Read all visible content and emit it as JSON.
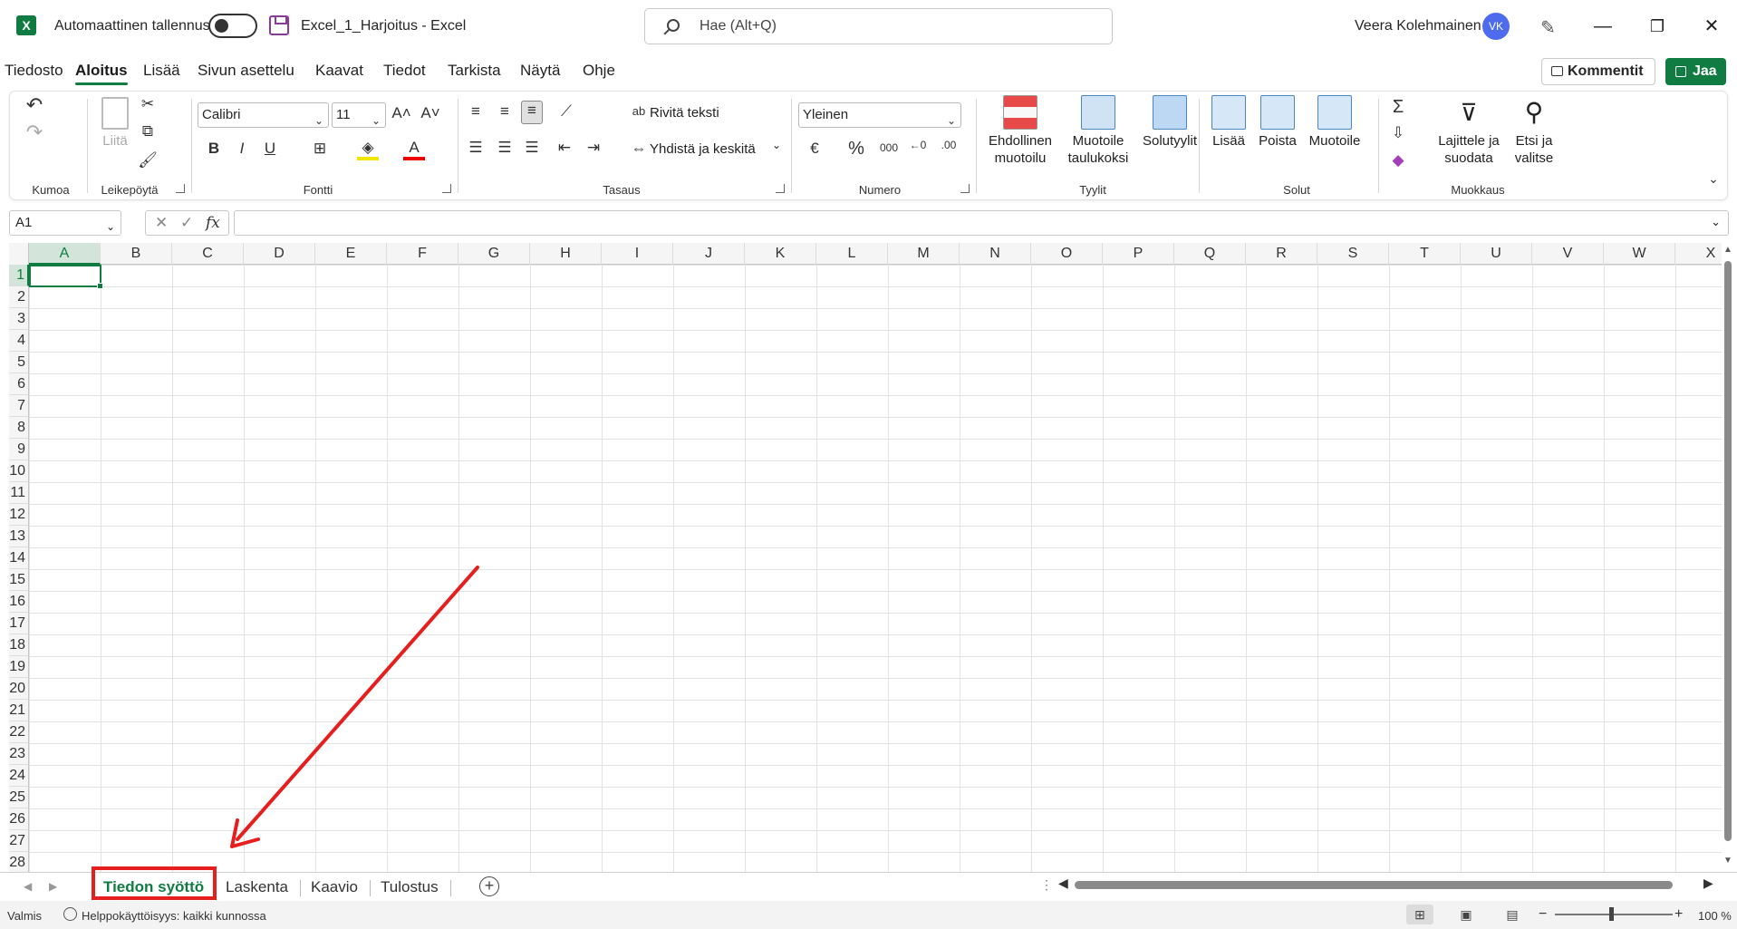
{
  "titlebar": {
    "app_logo": "X",
    "autosave_label": "Automaattinen tallennus",
    "doc_title": "Excel_1_Harjoitus  -  Excel",
    "search_placeholder": "Hae (Alt+Q)",
    "user_name": "Veera Kolehmainen",
    "user_initials": "VK",
    "minimize": "—",
    "restore": "❐",
    "close": "✕"
  },
  "menu": {
    "tabs": [
      "Tiedosto",
      "Aloitus",
      "Lisää",
      "Sivun asettelu",
      "Kaavat",
      "Tiedot",
      "Tarkista",
      "Näytä",
      "Ohje"
    ],
    "active_tab": "Aloitus",
    "comments_label": "Kommentit",
    "share_label": "Jaa"
  },
  "ribbon": {
    "groups": {
      "undo": "Kumoa",
      "clipboard": "Leikepöytä",
      "font": "Fontti",
      "alignment": "Tasaus",
      "number": "Numero",
      "styles": "Tyylit",
      "cells": "Solut",
      "editing": "Muokkaus"
    },
    "paste_label": "Liitä",
    "font_name": "Calibri",
    "font_size": "11",
    "bold": "B",
    "italic": "I",
    "underline": "U",
    "wrap_text": "Rivitä teksti",
    "merge_center": "Yhdistä ja keskitä",
    "number_format": "Yleinen",
    "percent": "%",
    "thousands": "000",
    "conditional_1": "Ehdollinen",
    "conditional_2": "muotoilu",
    "format_table_1": "Muotoile",
    "format_table_2": "taulukoksi",
    "cell_styles": "Solutyylit",
    "insert": "Lisää",
    "delete": "Poista",
    "format": "Muotoile",
    "sort_1": "Lajittele ja",
    "sort_2": "suodata",
    "find_1": "Etsi ja",
    "find_2": "valitse"
  },
  "formula_bar": {
    "name_box": "A1",
    "fx_label": "fx",
    "formula": ""
  },
  "grid": {
    "columns": [
      "A",
      "B",
      "C",
      "D",
      "E",
      "F",
      "G",
      "H",
      "I",
      "J",
      "K",
      "L",
      "M",
      "N",
      "O",
      "P",
      "Q",
      "R",
      "S",
      "T",
      "U",
      "V",
      "W",
      "X"
    ],
    "rows": [
      "1",
      "2",
      "3",
      "4",
      "5",
      "6",
      "7",
      "8",
      "9",
      "10",
      "11",
      "12",
      "13",
      "14",
      "15",
      "16",
      "17",
      "18",
      "19",
      "20",
      "21",
      "22",
      "23",
      "24",
      "25",
      "26",
      "27",
      "28"
    ],
    "selected_column": "A",
    "selected_row": "1"
  },
  "sheets": {
    "tabs": [
      "Tiedon syöttö",
      "Laskenta",
      "Kaavio",
      "Tulostus"
    ],
    "active": "Tiedon syöttö"
  },
  "status": {
    "ready": "Valmis",
    "accessibility": "Helppokäyttöisyys: kaikki kunnossa",
    "zoom": "100 %"
  },
  "colors": {
    "accent": "#107c41",
    "annotation": "#e61e1e"
  }
}
